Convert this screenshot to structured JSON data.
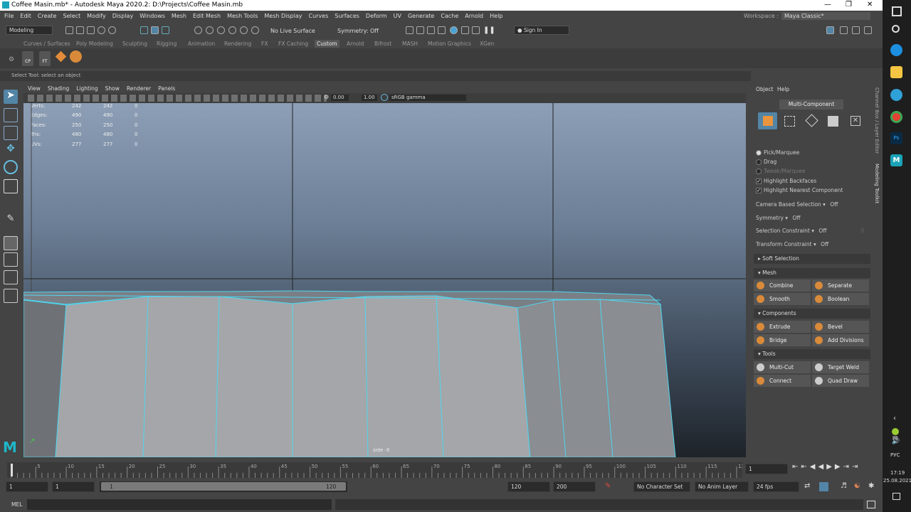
{
  "title": "Coffee Masin.mb* - Autodesk Maya 2020.2: D:\\Projects\\Coffee Masin.mb",
  "menu": [
    "File",
    "Edit",
    "Create",
    "Select",
    "Modify",
    "Display",
    "Windows",
    "Mesh",
    "Edit Mesh",
    "Mesh Tools",
    "Mesh Display",
    "Curves",
    "Surfaces",
    "Deform",
    "UV",
    "Generate",
    "Cache",
    "Arnold",
    "Help"
  ],
  "workspace": {
    "label": "Workspace :",
    "value": "Maya Classic*"
  },
  "status": {
    "mode": "Modeling",
    "live_surface": "No Live Surface",
    "symmetry": "Symmetry: Off",
    "sign_in": "Sign In"
  },
  "shelf_tabs": [
    "Curves / Surfaces",
    "Poly Modeling",
    "Sculpting",
    "Rigging",
    "Animation",
    "Rendering",
    "FX",
    "FX Caching",
    "Custom",
    "Arnold",
    "Bifrost",
    "MASH",
    "Motion Graphics",
    "XGen"
  ],
  "shelf_active": "Custom",
  "shelf_icons": [
    "CP",
    "FT"
  ],
  "help_line": "Select Tool: select an object",
  "viewport": {
    "menu": [
      "View",
      "Shading",
      "Lighting",
      "Show",
      "Renderer",
      "Panels"
    ],
    "exposure": "0.00",
    "gamma": "1.00",
    "color_space": "sRGB gamma",
    "hud": [
      [
        "Verts:",
        "242",
        "242",
        "0"
      ],
      [
        "Edges:",
        "490",
        "490",
        "0"
      ],
      [
        "Faces:",
        "250",
        "250",
        "0"
      ],
      [
        "Tris:",
        "480",
        "480",
        "0"
      ],
      [
        "UVs:",
        "277",
        "277",
        "0"
      ]
    ],
    "camera": "side -X"
  },
  "modeling_toolkit": {
    "menu": [
      "Object",
      "Help"
    ],
    "mode_button": "Multi-Component",
    "pick_marquee": "Pick/Marquee",
    "drag": "Drag",
    "tweak_marquee": "Tweak/Marquee",
    "highlight_backfaces": "Highlight Backfaces",
    "highlight_nearest": "Highlight Nearest Component",
    "camera_based": {
      "label": "Camera Based Selection",
      "value": "Off"
    },
    "symmetry": {
      "label": "Symmetry",
      "value": "Off"
    },
    "sel_constraint": {
      "label": "Selection Constraint",
      "value": "Off",
      "num": "0"
    },
    "xform_constraint": {
      "label": "Transform Constraint",
      "value": "Off"
    },
    "soft_selection": "Soft Selection",
    "mesh_header": "Mesh",
    "mesh": [
      "Combine",
      "Separate",
      "Smooth",
      "Boolean"
    ],
    "components_header": "Components",
    "components": [
      "Extrude",
      "Bevel",
      "Bridge",
      "Add Divisions"
    ],
    "tools_header": "Tools",
    "tools": [
      "Multi-Cut",
      "Target Weld",
      "Connect",
      "Quad Draw"
    ]
  },
  "side_tabs": [
    "Channel Box / Layer Editor",
    "Modeling Toolkit"
  ],
  "timeline": {
    "ticks": [
      "5",
      "10",
      "15",
      "20",
      "25",
      "30",
      "35",
      "40",
      "45",
      "50",
      "55",
      "60",
      "65",
      "70",
      "75",
      "80",
      "85",
      "90",
      "95",
      "100",
      "105",
      "110",
      "115",
      "120"
    ],
    "current": "1",
    "range": {
      "start": "1",
      "inner_start": "1",
      "slider_start": "1",
      "slider_end": "120",
      "end": "120",
      "max": "200"
    },
    "character_set": "No Character Set",
    "anim_layer": "No Anim Layer",
    "fps": "24 fps"
  },
  "mel": "MEL",
  "taskbar": {
    "lang": "РУС",
    "time": "17:19",
    "date": "25.08.2021"
  }
}
